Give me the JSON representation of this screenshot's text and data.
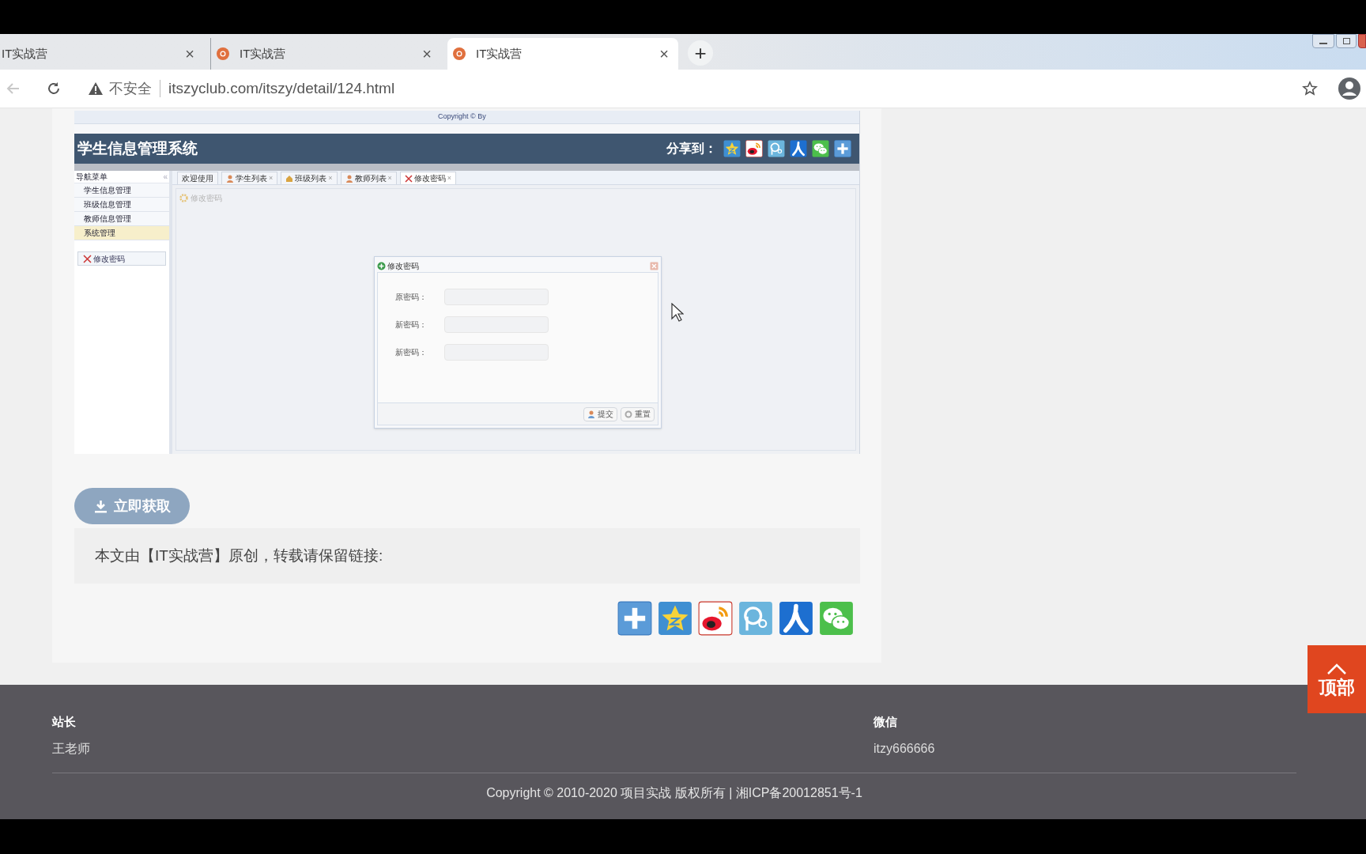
{
  "browser": {
    "tabs": [
      {
        "title": "IT实战营",
        "favicon": false,
        "selected": false
      },
      {
        "title": "IT实战营",
        "favicon": true,
        "selected": false
      },
      {
        "title": "IT实战营",
        "favicon": true,
        "selected": true
      }
    ],
    "new_tab": "+",
    "close_mark": "×",
    "address": {
      "security": "不安全",
      "url": "itszyclub.com/itszy/detail/124.html"
    }
  },
  "screenshot": {
    "copyright": "Copyright © By",
    "title": "学生信息管理系统",
    "share_label": "分享到：",
    "share_icons": [
      {
        "kind": "qzone"
      },
      {
        "kind": "weibo"
      },
      {
        "kind": "tqq"
      },
      {
        "kind": "renren"
      },
      {
        "kind": "wechat"
      },
      {
        "kind": "plus"
      }
    ],
    "menu_title": "导航菜单",
    "collapse_mark": "«",
    "menu": [
      {
        "label": "学生信息管理",
        "selected": false
      },
      {
        "label": "班级信息管理",
        "selected": false
      },
      {
        "label": "教师信息管理",
        "selected": false
      },
      {
        "label": "系统管理",
        "selected": true
      }
    ],
    "side_button": "修改密码",
    "tabs": [
      {
        "label": "欢迎使用",
        "selected": false
      },
      {
        "label": "学生列表",
        "close_mark": "×",
        "selected": false
      },
      {
        "label": "班级列表",
        "close_mark": "×",
        "selected": false
      },
      {
        "label": "教师列表",
        "close_mark": "×",
        "selected": false
      },
      {
        "label": "修改密码",
        "close_mark": "×",
        "selected": true
      }
    ],
    "panel_title": "修改密码",
    "dialog": {
      "title": "修改密码",
      "fields": [
        {
          "label": "原密码："
        },
        {
          "label": "新密码："
        },
        {
          "label": "新密码："
        }
      ],
      "buttons": [
        "提交",
        "重置"
      ]
    }
  },
  "download_button": "立即获取",
  "notice": "本文由【IT实战营】原创，转载请保留链接:",
  "share_icons": [
    {
      "kind": "plus"
    },
    {
      "kind": "qzone"
    },
    {
      "kind": "weibo"
    },
    {
      "kind": "tqq"
    },
    {
      "kind": "renren"
    },
    {
      "kind": "wechat"
    }
  ],
  "footer": {
    "columns": [
      {
        "heading": "站长",
        "value": "王老师"
      },
      {
        "heading": "微信",
        "value": "itzy666666"
      }
    ],
    "copyright": "Copyright © 2010-2020 项目实战 版权所有 | 湘ICP备20012851号-1"
  },
  "back_to_top": "顶部"
}
